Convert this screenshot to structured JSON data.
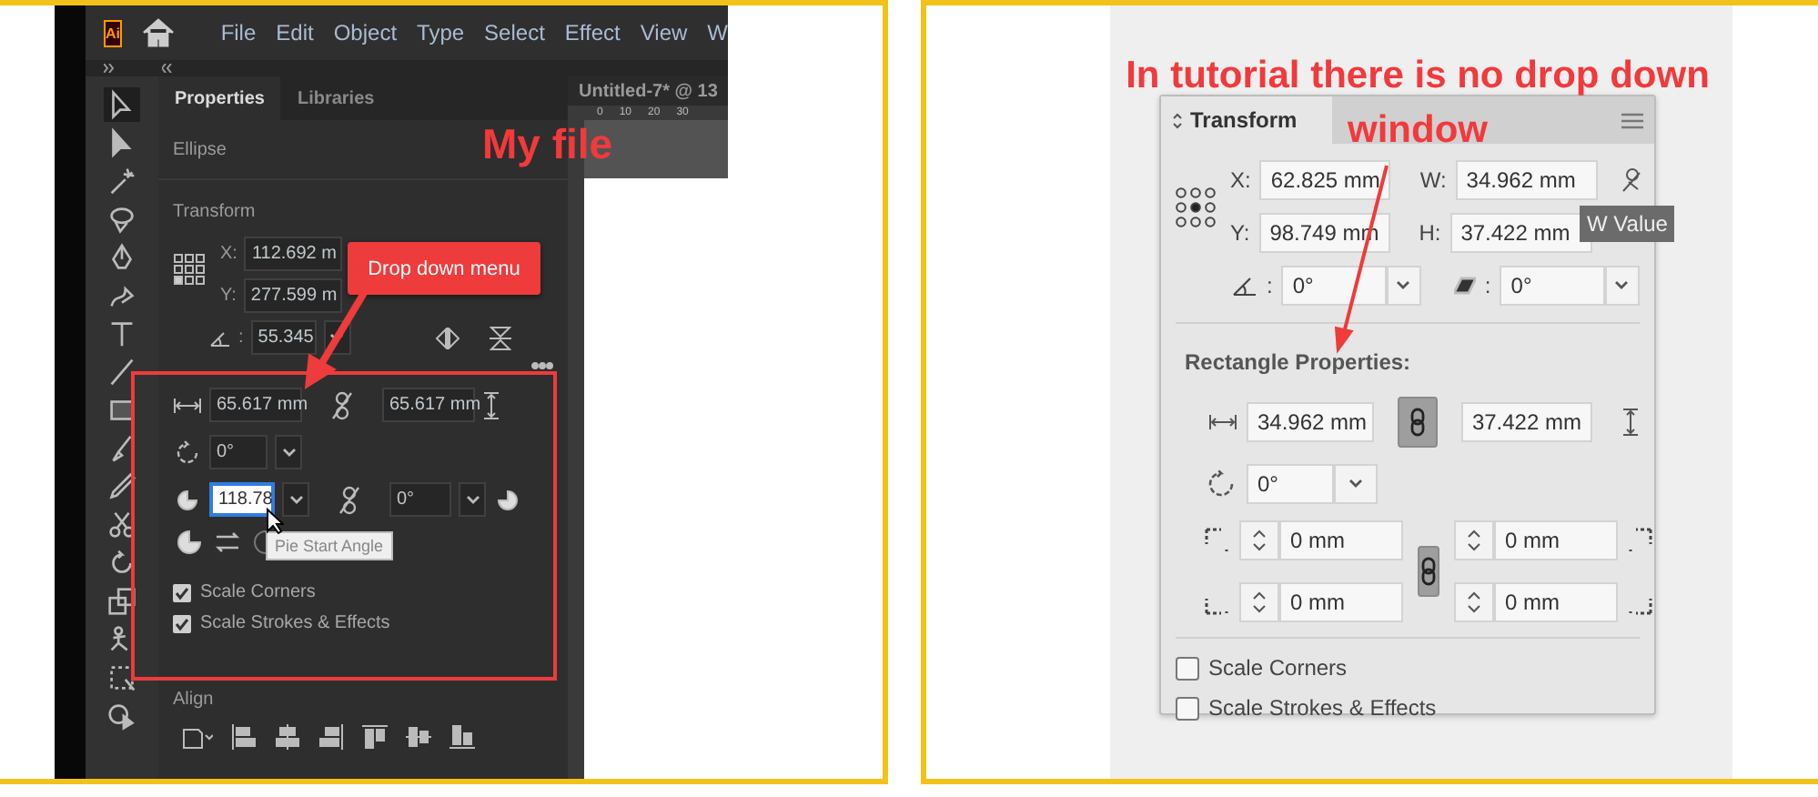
{
  "my_file": {
    "annotation": "My file",
    "callout": "Drop down menu",
    "logo": "Ai",
    "menu": [
      "File",
      "Edit",
      "Object",
      "Type",
      "Select",
      "Effect",
      "View",
      "W"
    ],
    "document_tab": "Untitled-7* @ 13",
    "ruler_labels": [
      "0",
      "10",
      "20",
      "30"
    ],
    "panel_tabs": [
      {
        "label": "Properties",
        "selected": true
      },
      {
        "label": "Libraries",
        "selected": false
      }
    ],
    "object_type": "Ellipse",
    "transform": {
      "title": "Transform",
      "x_label": "X:",
      "x": "112.692 m",
      "y_label": "Y:",
      "y": "277.599 m",
      "angle_label": ":",
      "angle": "55.345"
    },
    "ellipse": {
      "width": "65.617 mm",
      "height": "65.617 mm",
      "rotation": "0°",
      "pie_start": "118.78",
      "pie_start_focused": true,
      "pie_end": "0°"
    },
    "tooltip": "Pie Start Angle",
    "checkboxes": [
      {
        "label": "Scale Corners",
        "checked": true
      },
      {
        "label": "Scale Strokes & Effects",
        "checked": true
      }
    ],
    "align_title": "Align"
  },
  "tutorial": {
    "annotation_lines": [
      "In tutorial there is no drop down",
      "window"
    ],
    "panel_title": "Transform",
    "x_label": "X:",
    "x": "62.825 mm",
    "w_label": "W:",
    "w": "34.962 mm",
    "y_label": "Y:",
    "y": "98.749 mm",
    "h_label": "H:",
    "h": "37.422 mm",
    "tooltip": "W Value",
    "angle_label": ":",
    "angle": "0°",
    "shear_label": ":",
    "shear": "0°",
    "section_title": "Rectangle Properties:",
    "rect_width": "34.962 mm",
    "rect_height": "37.422 mm",
    "rotation": "0°",
    "corners": [
      "0 mm",
      "0 mm",
      "0 mm",
      "0 mm"
    ],
    "checkboxes": [
      {
        "label": "Scale Corners",
        "checked": false
      },
      {
        "label": "Scale Strokes & Effects",
        "checked": false
      }
    ]
  }
}
